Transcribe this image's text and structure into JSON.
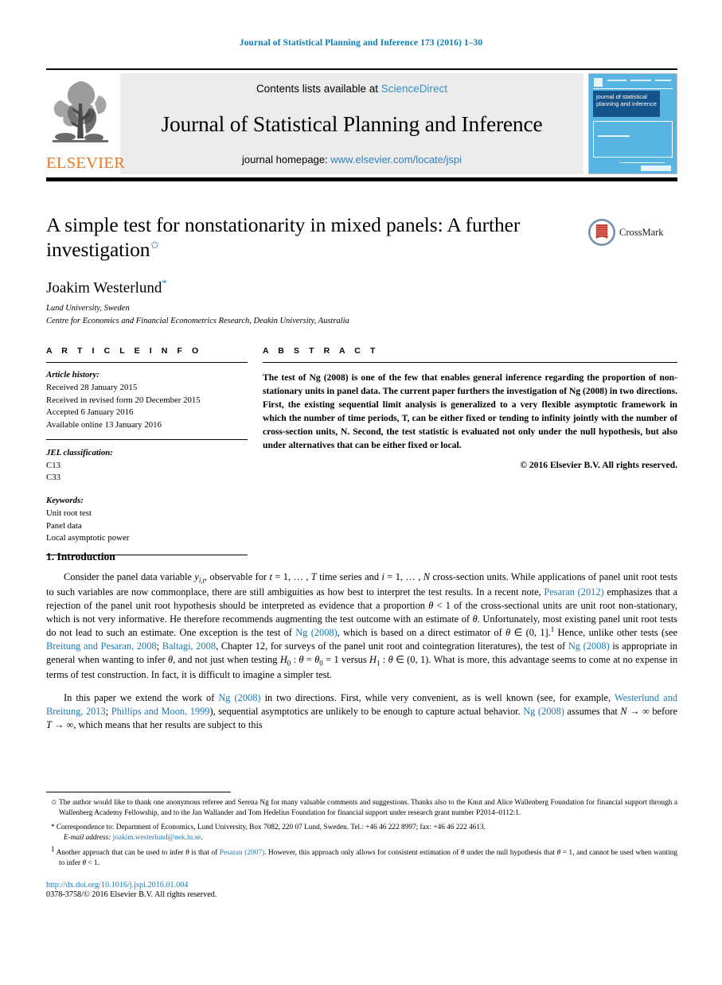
{
  "running_head": "Journal of Statistical Planning and Inference 173 (2016) 1–30",
  "masthead": {
    "contents_prefix": "Contents lists available at ",
    "sciencedirect": "ScienceDirect",
    "journal_title": "Journal of Statistical Planning and Inference",
    "homepage_prefix": "journal homepage: ",
    "homepage_url": "www.elsevier.com/locate/jspi",
    "publisher_wordmark": "ELSEVIER",
    "cover_title": "journal of statistical planning and inference"
  },
  "article": {
    "title": "A simple test for nonstationarity in mixed panels: A further investigation",
    "title_marker": "✩",
    "crossmark_label": "CrossMark",
    "author": "Joakim Westerlund",
    "author_marker": "*",
    "affiliations": [
      "Lund University, Sweden",
      "Centre for Economics and Financial Econometrics Research, Deakin University, Australia"
    ]
  },
  "info": {
    "heading": "A R T I C L E   I N F O",
    "history_label": "Article history:",
    "history": [
      "Received 28 January 2015",
      "Received in revised form 20 December 2015",
      "Accepted 6 January 2016",
      "Available online 13 January 2016"
    ],
    "jel_label": "JEL classification:",
    "jel": [
      "C13",
      "C33"
    ],
    "keywords_label": "Keywords:",
    "keywords": [
      "Unit root test",
      "Panel data",
      "Local asymptotic power"
    ]
  },
  "abstract": {
    "heading": "A B S T R A C T",
    "body": "The test of Ng (2008) is one of the few that enables general inference regarding the proportion of non-stationary units in panel data. The current paper furthers the investigation of Ng (2008) in two directions. First, the existing sequential limit analysis is generalized to a very flexible asymptotic framework in which the number of time periods, T, can be either fixed or tending to infinity jointly with the number of cross-section units, N. Second, the test statistic is evaluated not only under the null hypothesis, but also under alternatives that can be either fixed or local.",
    "copyright": "© 2016 Elsevier B.V. All rights reserved."
  },
  "section": {
    "heading": "1. Introduction",
    "paragraph1": {
      "p1a": "Consider the panel data variable ",
      "p1b": ", observable for ",
      "p1c": " time series and ",
      "p1d": " cross-section units. While applications of panel unit root tests to such variables are now commonplace, there are still ambiguities as how best to interpret the test results. In a recent note, ",
      "cite_pesaran": "Pesaran",
      "cite_pesaran_year": "(2012)",
      "p1e": " emphasizes that a rejection of the panel unit root hypothesis should be interpreted as evidence that a proportion ",
      "p1f": " of the cross-sectional units are unit root non-stationary, which is not very informative. He therefore recommends augmenting the test outcome with an estimate of ",
      "p1g": ". Unfortunately, most existing panel unit root tests do not lead to such an estimate. One exception is the test of ",
      "cite_ng": "Ng",
      "cite_ng_year": "(2008)",
      "p1h": ", which is based on a direct estimator of ",
      "p1i": " Hence, unlike other tests (see ",
      "cite_breitung": "Breitung and Pesaran, 2008",
      "cite_baltagi": "Baltagi, 2008",
      "p1j": ", Chapter 12, for surveys of the panel unit root and cointegration literatures), the test of ",
      "p1k": " is appropriate in general when wanting to infer ",
      "p1l": ", and not just when testing ",
      "p1m": ". What is more, this advantage seems to come at no expense in terms of test construction. In fact, it is difficult to imagine a simpler test."
    },
    "paragraph2": {
      "p2a": "In this paper we extend the work of ",
      "p2b": " in two directions. First, while very convenient, as is well known (see, for example, ",
      "cite_wb": "Westerlund and Breitung, 2013",
      "cite_pm": "Phillips and Moon, 1999",
      "p2c": "), sequential asymptotics are unlikely to be enough to capture actual behavior. ",
      "p2d": " assumes that ",
      "p2e": " before ",
      "p2f": ", which means that her results are subject to this"
    }
  },
  "footnotes": {
    "star": {
      "mark": "✩",
      "text": "The author would like to thank one anonymous referee and Serena Ng for many valuable comments and suggestions. Thanks also to the Knut and Alice Wallenberg Foundation for financial support through a Wallenberg Academy Fellowship, and to the Jan Wallander and Tom Hedelius Foundation for financial support under research grant number P2014–0112:1."
    },
    "correspondence": {
      "mark": "*",
      "text": "Correspondence to: Department of Economics, Lund University, Box 7082, 220 07 Lund, Sweden. Tel.: +46 46 222 8997; fax: +46 46 222 4613."
    },
    "email": {
      "label": "E-mail address:",
      "value": "joakim.westerlund@nek.lu.se"
    },
    "note1": {
      "mark": "1",
      "a": "Another approach that can be used to infer ",
      "b": " is that of ",
      "cite": "Pesaran",
      "cite_year": "(2007)",
      "c": ". However, this approach only allows for consistent estimation of ",
      "d": " under the null hypothesis that ",
      "e": ", and cannot be used when wanting to infer ",
      "f": "."
    }
  },
  "footer": {
    "doi": "http://dx.doi.org/10.1016/j.jspi.2016.01.004",
    "issn": "0378-3758/© 2016 Elsevier B.V. All rights reserved."
  },
  "colors": {
    "link_blue": "#1a79b5",
    "header_blue": "#0b7eb0",
    "elsevier_orange": "#E87722",
    "cover_blue": "#58b5e3",
    "cover_block_blue": "#15538c"
  }
}
